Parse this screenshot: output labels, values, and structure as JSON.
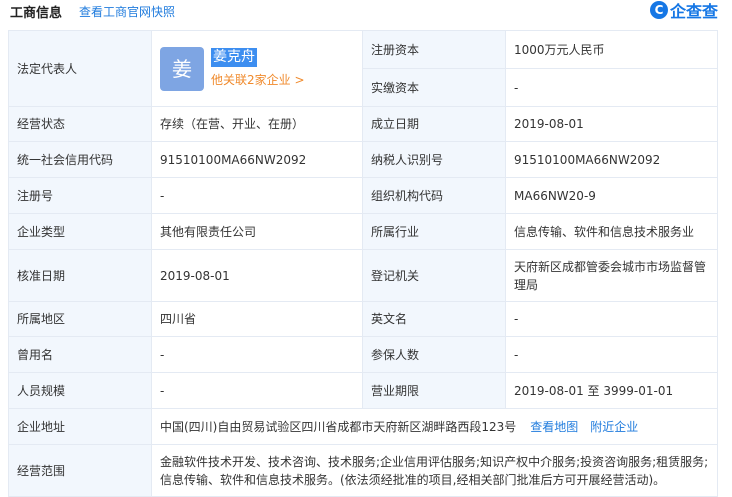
{
  "header": {
    "title": "工商信息",
    "snapshot_link": "查看工商官网快照",
    "brand_mark": "C",
    "brand_name": "企查查"
  },
  "legal_rep": {
    "label": "法定代表人",
    "avatar_char": "姜",
    "name": "姜克舟",
    "related": "他关联2家企业 >"
  },
  "rows": {
    "reg_capital": {
      "label": "注册资本",
      "value": "1000万元人民币"
    },
    "paid_capital": {
      "label": "实缴资本",
      "value": "-"
    },
    "status": {
      "label": "经营状态",
      "value": "存续（在营、开业、在册）"
    },
    "established": {
      "label": "成立日期",
      "value": "2019-08-01"
    },
    "credit_code": {
      "label": "统一社会信用代码",
      "value": "91510100MA66NW2092"
    },
    "taxpayer_id": {
      "label": "纳税人识别号",
      "value": "91510100MA66NW2092"
    },
    "reg_no": {
      "label": "注册号",
      "value": "-"
    },
    "org_code": {
      "label": "组织机构代码",
      "value": "MA66NW20-9"
    },
    "company_type": {
      "label": "企业类型",
      "value": "其他有限责任公司"
    },
    "industry": {
      "label": "所属行业",
      "value": "信息传输、软件和信息技术服务业"
    },
    "approval_date": {
      "label": "核准日期",
      "value": "2019-08-01"
    },
    "authority": {
      "label": "登记机关",
      "value": "天府新区成都管委会城市市场监督管理局"
    },
    "region": {
      "label": "所属地区",
      "value": "四川省"
    },
    "english_name": {
      "label": "英文名",
      "value": "-"
    },
    "former_name": {
      "label": "曾用名",
      "value": "-"
    },
    "insured": {
      "label": "参保人数",
      "value": "-"
    },
    "staff_size": {
      "label": "人员规模",
      "value": "-"
    },
    "term": {
      "label": "营业期限",
      "value": "2019-08-01 至 3999-01-01"
    },
    "address": {
      "label": "企业地址",
      "value": "中国(四川)自由贸易试验区四川省成都市天府新区湖畔路西段123号",
      "map_link": "查看地图",
      "nearby_link": "附近企业"
    },
    "scope": {
      "label": "经营范围",
      "value": "金融软件技术开发、技术咨询、技术服务;企业信用评估服务;知识产权中介服务;投资咨询服务;租赁服务;信息传输、软件和信息技术服务。(依法须经批准的项目,经相关部门批准后方可开展经营活动)。"
    }
  },
  "colors": {
    "label_bg": "#f2f7fd",
    "border": "#e4eaf3",
    "link": "#1f7bdd",
    "accent_orange": "#f08a2c",
    "brand_blue": "#1677e5",
    "avatar_bg": "#7ea5e3"
  }
}
